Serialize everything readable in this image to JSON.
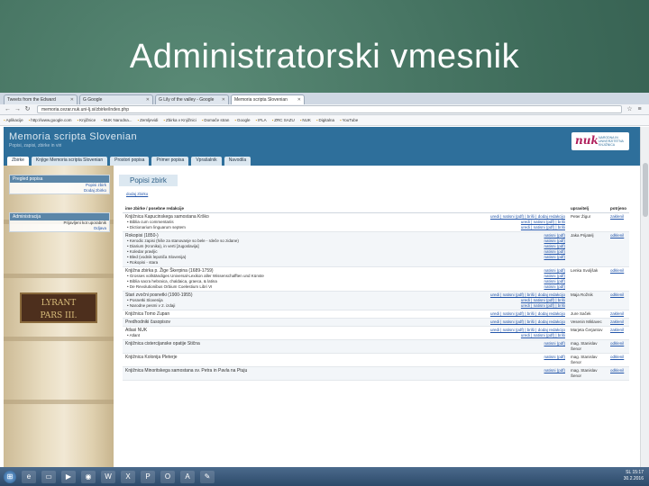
{
  "slide": {
    "title": "Administratorski vmesnik"
  },
  "browser": {
    "tabs": [
      {
        "label": "Tweets from the Edward",
        "active": false
      },
      {
        "label": "G Google",
        "active": false
      },
      {
        "label": "G Lily of the valley - Google",
        "active": false
      },
      {
        "label": "Memoria scripta Slovenian",
        "active": true
      }
    ],
    "url": "memoria.cezar.nuk.uni-lj.si/zbirke/index.php",
    "bookmarks": [
      "Aplikacije",
      "http://www.google.com",
      "Knjižnice",
      "NUK Narodna...",
      "Zemljevidi",
      "Zbirka v Knjižnici",
      "Domače stran",
      "Google",
      "IFLA",
      "ZRC SAZU",
      "NUK",
      "Digitalna",
      "YouTube"
    ]
  },
  "site": {
    "name": "Memoria scripta Slovenian",
    "subtitle": "Popisi, zapisi, zbirke in viri",
    "logo_mark": "nuk",
    "logo_text": "NARODNA IN UNIVERZITETNA KNJIŽNICA",
    "nav": [
      "Zbirke",
      "Knjige Memoria scripta Slovenian",
      "Prostori popisa",
      "Primer popisa",
      "Vprašalnik",
      "Navodila"
    ],
    "sidebar": {
      "box1": {
        "title": "Pregled popisa",
        "links": [
          "Popisi zbirk",
          "Dodaj zbirko"
        ]
      },
      "box2": {
        "title": "Administracija",
        "links": [
          "Prijavljeni kot uporabnik",
          "Odjava"
        ]
      },
      "book_plate": [
        "LYRANT",
        "PARS III."
      ]
    }
  },
  "main": {
    "page_title": "Popisi zbirk",
    "add_link": "dodaj zbirko",
    "columns": [
      "ime zbirke / posebne redakcije",
      "",
      "upravitelj",
      "potrjeno"
    ],
    "rows": [
      {
        "name": "Knjižnica Kapucinskega samostana Krško",
        "subs": [
          "Biblia cum commentariis",
          "Dictionarium linguarum septem"
        ],
        "actions": [
          "uredi | natisni (pdf) | briši | dodaj redakcijo",
          "uredi | natisni (pdf) | briši",
          "uredi | natisni (pdf) | briši"
        ],
        "manager": "Peter Žigur",
        "status": "zaklenil"
      },
      {
        "name": "Rokopisi (1850-)",
        "subs": [
          "Kerodic zapisi (hiše za stanovanje so bele - rdeče so zidane)",
          "Diarium (Kronika), in verti [Jugoslavija]",
          "Koledar pravljic",
          "Bled (vodnik lepotiča Slovenija)",
          "Rokopisi - stara"
        ],
        "actions": [
          "natisni (pdf)",
          "natisni (pdf)",
          "natisni (pdf)",
          "natisni (pdf)",
          "natisni (pdf)"
        ],
        "manager": "Jaka Prijatelj",
        "status": "odklenil"
      },
      {
        "name": "Knjižna zbirka p. Žige Škerpina (1689-1759)",
        "subs": [
          "Grosses vollständiges Universal-Lexikon aller Wissenschafften und Künste",
          "Biblia sacra hebraica, chaldaica, graeca, & latina",
          "De Revolutionibus Orbium Coelestium Libri VI"
        ],
        "actions": [
          "natisni (pdf)",
          "natisni (pdf)",
          "natisni (pdf)",
          "natisni (pdf)"
        ],
        "manager": "Lenka Svoljšak",
        "status": "odklenil"
      },
      {
        "name": "Stari zvočni posnetki (1900-1955)",
        "subs": [
          "Posnetki Slovenija",
          "Narodne pesmi v 2. izdaji"
        ],
        "actions": [
          "uredi | natisni (pdf) | briši | dodaj redakcijo",
          "uredi | natisni (pdf) | briši",
          "uredi | natisni (pdf) | briši"
        ],
        "manager": "Maja Rožnik",
        "status": "odklenil"
      },
      {
        "name": "Knjižnica Tomo Zupan",
        "subs": [],
        "actions": [
          "uredi | natisni (pdf) | briši | dodaj redakcijo"
        ],
        "manager": "Jure Saček",
        "status": "zaklenil"
      },
      {
        "name": "Predhodniki časopisov",
        "subs": [],
        "actions": [
          "uredi | natisni (pdf) | briši | dodaj redakcijo"
        ],
        "manager": "Vesenin Miklavec",
        "status": "zaklenil"
      },
      {
        "name": "Atlasi NUK",
        "subs": [
          "Atlant"
        ],
        "actions": [
          "uredi | natisni (pdf) | briši | dodaj redakcijo",
          "uredi | natisni (pdf) | briši"
        ],
        "manager": "Marjeta Čerjantov",
        "status": "zaklenil"
      },
      {
        "name": "Knjižnica cistercijanske opatije Stična",
        "subs": [],
        "actions": [
          "natisni (pdf)"
        ],
        "manager": "mag. Stanislav Šenor",
        "status": "odklenil"
      },
      {
        "name": "Knjižnica Kolonija Pleterje",
        "subs": [],
        "actions": [
          "natisni (pdf)"
        ],
        "manager": "mag. Stanislav Šenor",
        "status": "odklenil"
      },
      {
        "name": "Knjižnica Minoritskega samostana sv. Petra in Pavla na Ptuju",
        "subs": [],
        "actions": [
          "natisni (pdf)"
        ],
        "manager": "mag. Stanislav Šenor",
        "status": "odklenil"
      }
    ]
  },
  "taskbar": {
    "icons": [
      "ie-icon",
      "explorer-icon",
      "media-icon",
      "chrome-icon",
      "word-icon",
      "excel-icon",
      "powerpoint-icon",
      "outlook-icon",
      "acrobat-icon",
      "paint-icon"
    ],
    "time": "15:17",
    "date": "30.2.2016",
    "lang": "SL"
  }
}
